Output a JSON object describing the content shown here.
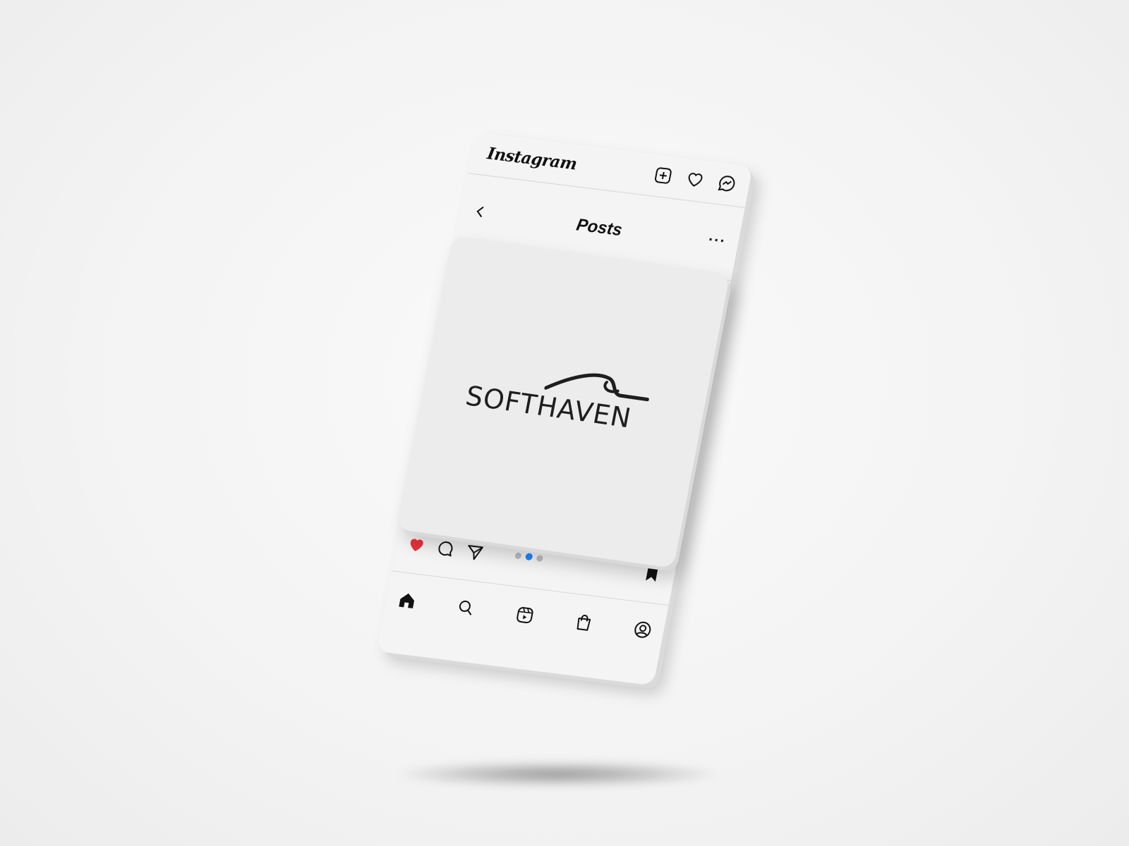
{
  "app": {
    "brand": "Instagram",
    "page_title": "Posts",
    "more_label": "···"
  },
  "post": {
    "logo_text": "SOFTHAVEN",
    "carousel": {
      "count": 3,
      "active_index": 1
    },
    "liked": true
  },
  "colors": {
    "like": "#e8323c",
    "active_dot": "#1e88ff",
    "inactive_dot": "#bdbdbd"
  },
  "icons": {
    "top": [
      "new-post-icon",
      "heart-icon",
      "messenger-icon"
    ],
    "actions": [
      "liked-heart-icon",
      "comment-icon",
      "share-icon"
    ],
    "save": "bookmark-icon",
    "nav": [
      "home-icon",
      "search-icon",
      "reels-icon",
      "shop-icon",
      "profile-icon"
    ]
  }
}
